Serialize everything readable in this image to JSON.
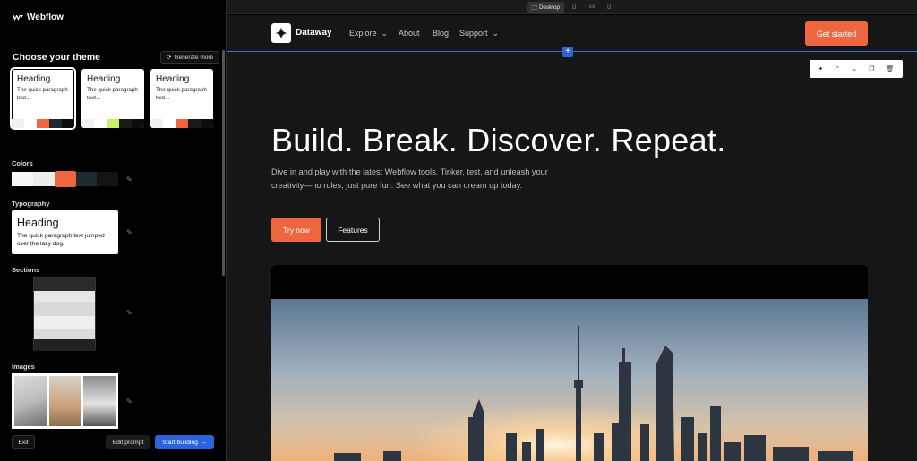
{
  "left_panel": {
    "brand": "Webflow",
    "theme_title": "Choose your theme",
    "generate_more": "Generate more",
    "themes": [
      {
        "heading": "Heading",
        "paragraph": "The quick paragraph text...",
        "swatches": [
          "#f1f1f1",
          "#ffffff",
          "#ee6640",
          "#1f2a30",
          "#0d0d0d"
        ]
      },
      {
        "heading": "Heading",
        "paragraph": "The quick paragraph text...",
        "swatches": [
          "#f1f1f1",
          "#ffffff",
          "#c8f06a",
          "#1a1a1a",
          "#0d0d0d"
        ]
      },
      {
        "heading": "Heading",
        "paragraph": "The quick paragraph text...",
        "swatches": [
          "#f1f1f1",
          "#ffffff",
          "#ee6640",
          "#1a1a1a",
          "#0d0d0d"
        ]
      }
    ],
    "colors_label": "Colors",
    "color_swatches": [
      "#f7f7f7",
      "#ededed",
      "#ee6640",
      "#1f2a30",
      "#141414"
    ],
    "typography_label": "Typography",
    "typography_heading": "Heading",
    "typography_paragraph": "The quick paragraph text jumped over the lazy dog.",
    "sections_label": "Sections",
    "images_label": "Images",
    "exit": "Exit",
    "edit_prompt": "Edit prompt",
    "start_building": "Start building"
  },
  "device_bar": {
    "desktop": "Desktop",
    "icons": [
      "tablet-landscape-icon",
      "tablet-portrait-icon",
      "mobile-icon"
    ]
  },
  "site": {
    "logo": "Dataway",
    "nav": [
      {
        "label": "Explore",
        "dropdown": true
      },
      {
        "label": "About",
        "dropdown": false
      },
      {
        "label": "Blog",
        "dropdown": false
      },
      {
        "label": "Support",
        "dropdown": true
      }
    ],
    "cta": "Get started",
    "hero_title": "Build. Break. Discover. Repeat.",
    "hero_subtitle": "Dive in and play with the latest Webflow tools. Tinker, test, and unleash your creativity—no rules, just pure fun. See what you can dream up today.",
    "primary_button": "Try now",
    "secondary_button": "Features"
  },
  "colors": {
    "accent": "#ee6640",
    "selection": "#2f62d8",
    "site_bg": "#161616"
  }
}
